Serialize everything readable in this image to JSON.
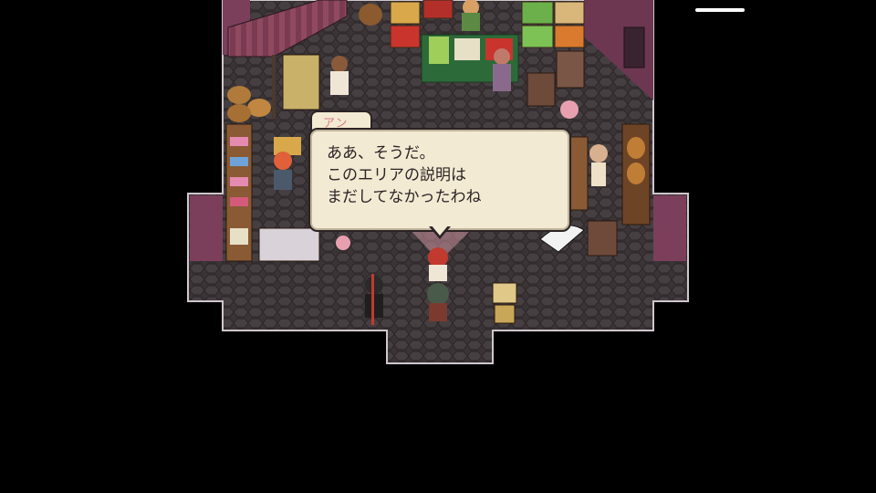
{
  "hud": {
    "menu_icon": "menu-bar-icon"
  },
  "dialogue": {
    "speaker": "アン",
    "lines": [
      "ああ、そうだ。",
      "このエリアの説明は",
      "まだしてなかったわね"
    ]
  },
  "colors": {
    "floor": "#3b3537",
    "wall": "#7b3f5c",
    "dialog_bg": "#f3ead3",
    "speaker_name": "#d67a88"
  }
}
